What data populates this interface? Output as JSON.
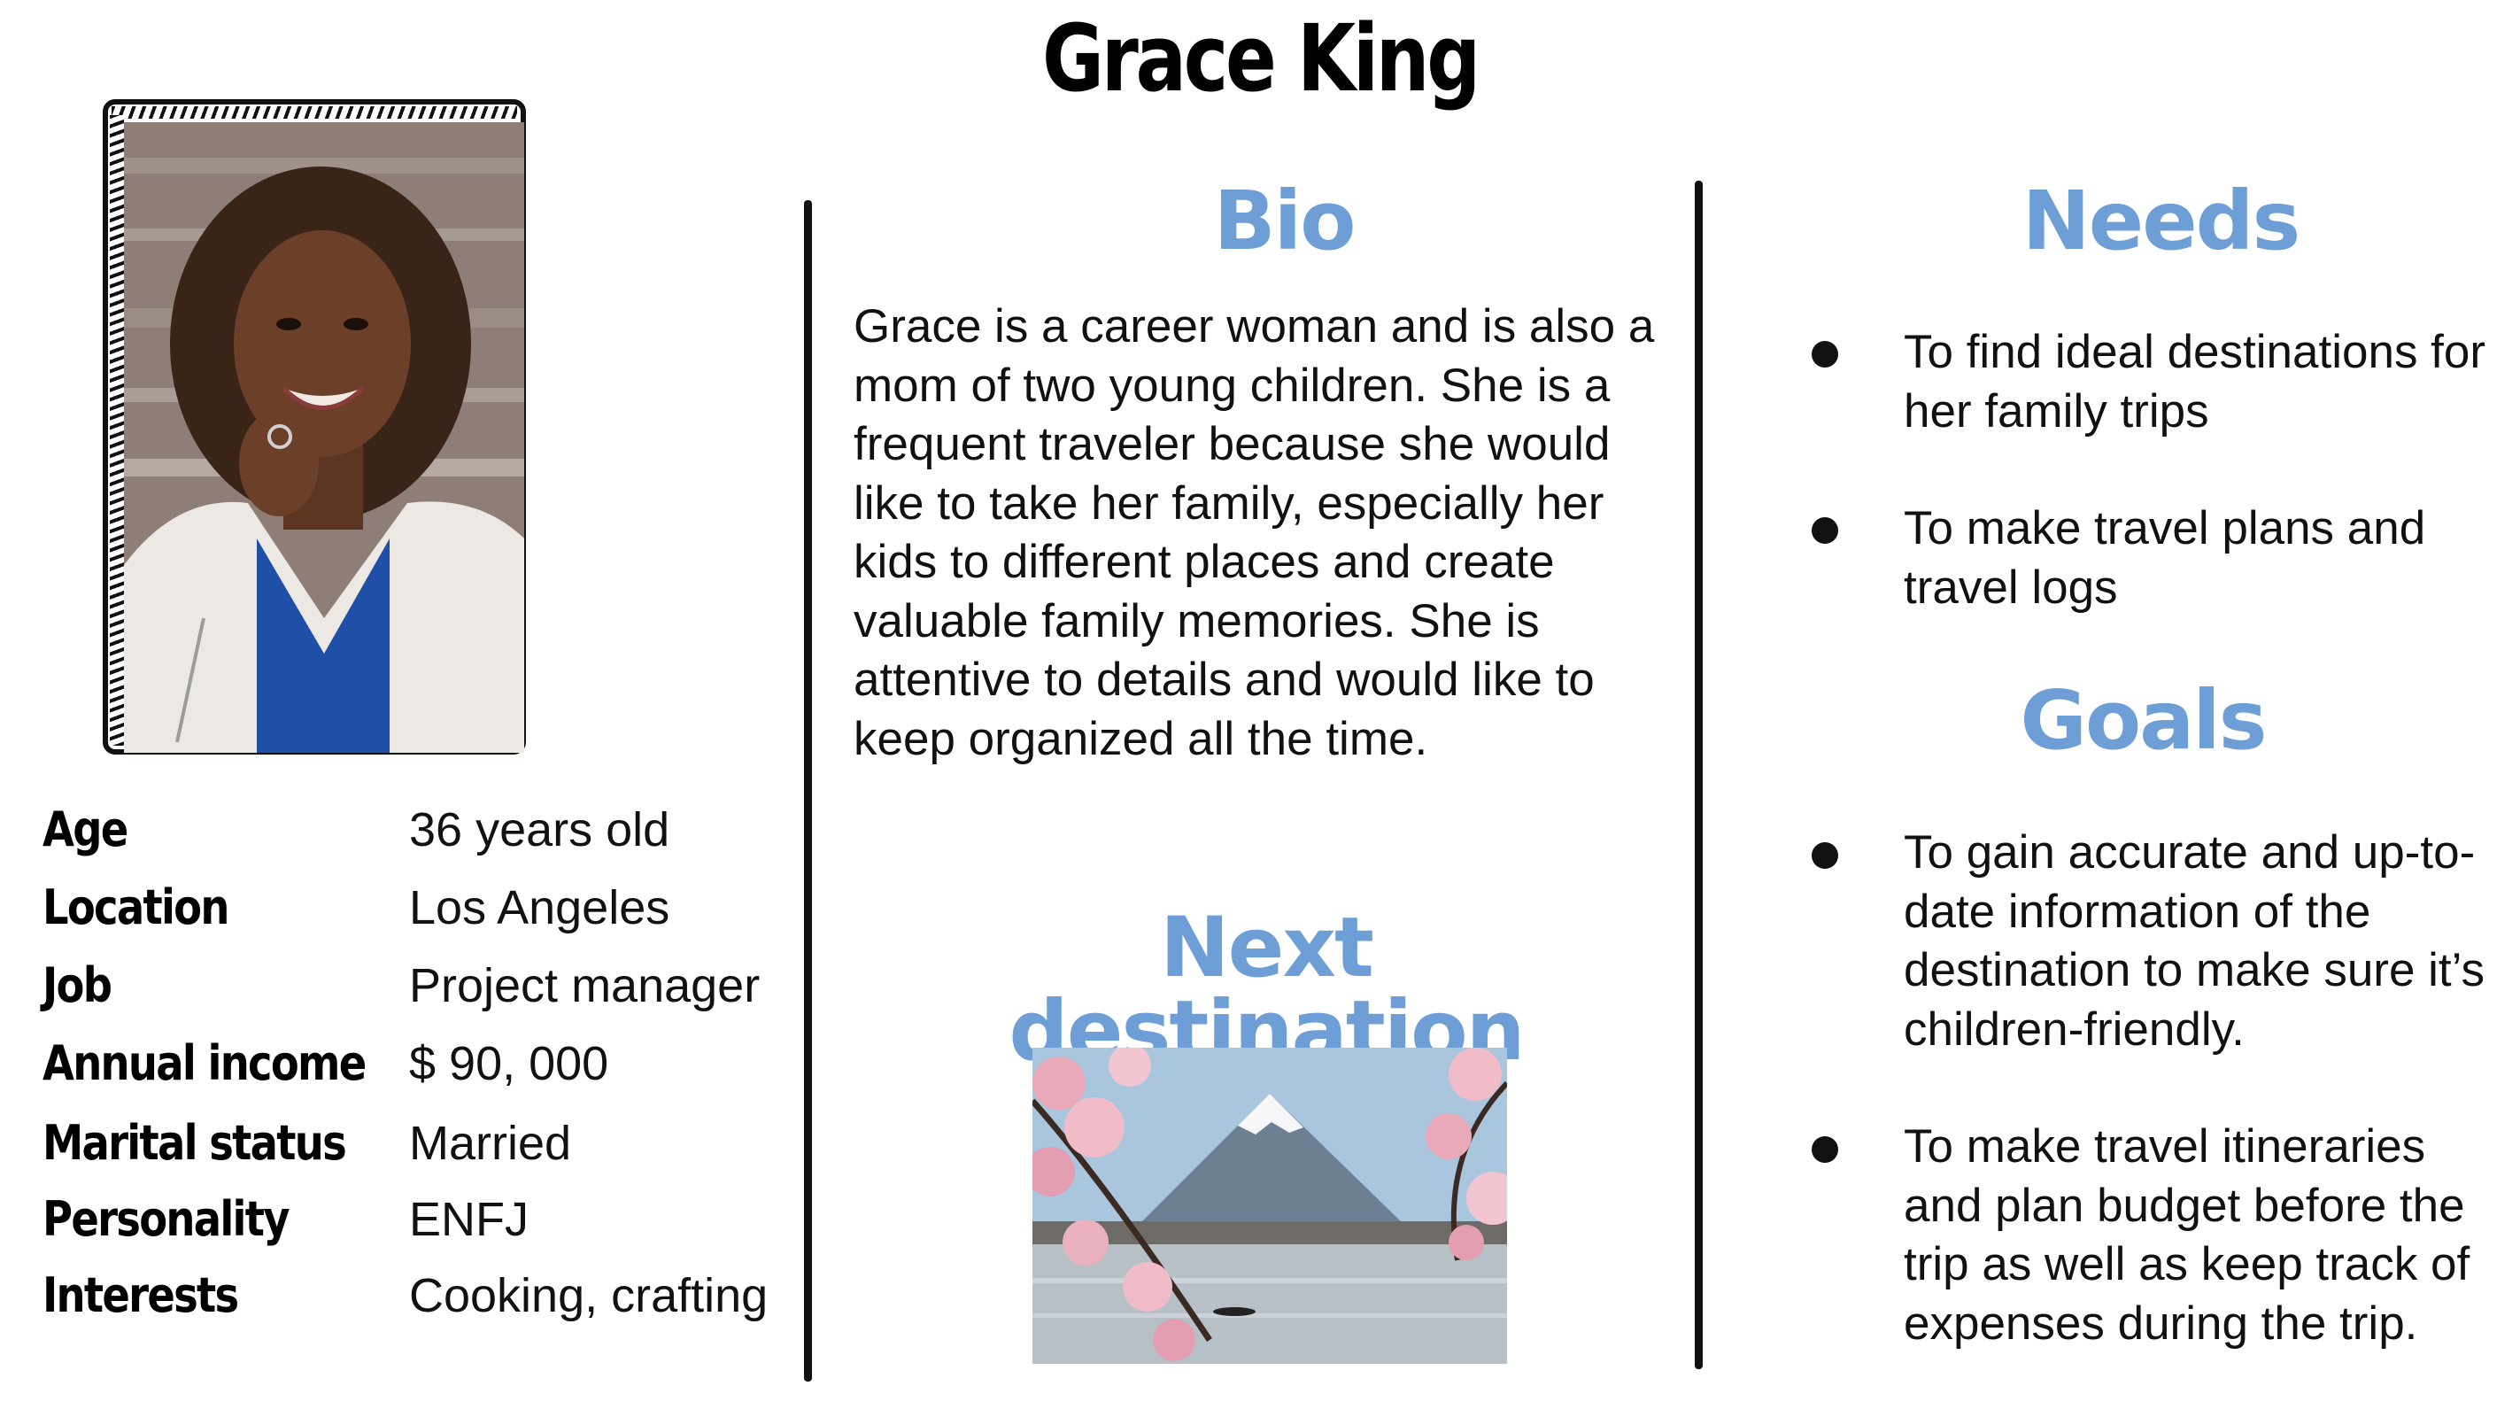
{
  "persona": {
    "name": "Grace King"
  },
  "attributes": [
    {
      "label": "Age",
      "value": "36 years old"
    },
    {
      "label": "Location",
      "value": "Los Angeles"
    },
    {
      "label": "Job",
      "value": "Project manager"
    },
    {
      "label": "Annual income",
      "value": "$ 90, 000"
    },
    {
      "label": "Marital status",
      "value": "Married"
    },
    {
      "label": "Personality",
      "value": "ENFJ"
    },
    {
      "label": "Interests",
      "value": "Cooking, crafting"
    }
  ],
  "bio": {
    "heading": "Bio",
    "text": "Grace is a career woman and is also a mom of two young children. She is a frequent traveler because she would like to take her family, especially her kids to different places and create valuable family memories. She is attentive to details and would like to keep organized all the time."
  },
  "next_destination": {
    "heading": "Next destination"
  },
  "needs": {
    "heading": "Needs",
    "items": [
      "To find ideal destinations for her family trips",
      "To make travel plans and travel logs"
    ]
  },
  "goals": {
    "heading": "Goals",
    "items": [
      "To gain accurate and up-to-date information of the destination to make sure it’s children-friendly.",
      "To make travel itineraries and plan budget before the trip as well as  keep track of expenses during the trip."
    ]
  },
  "colors": {
    "heading_blue": "#6d9fd6",
    "text": "#111111"
  }
}
